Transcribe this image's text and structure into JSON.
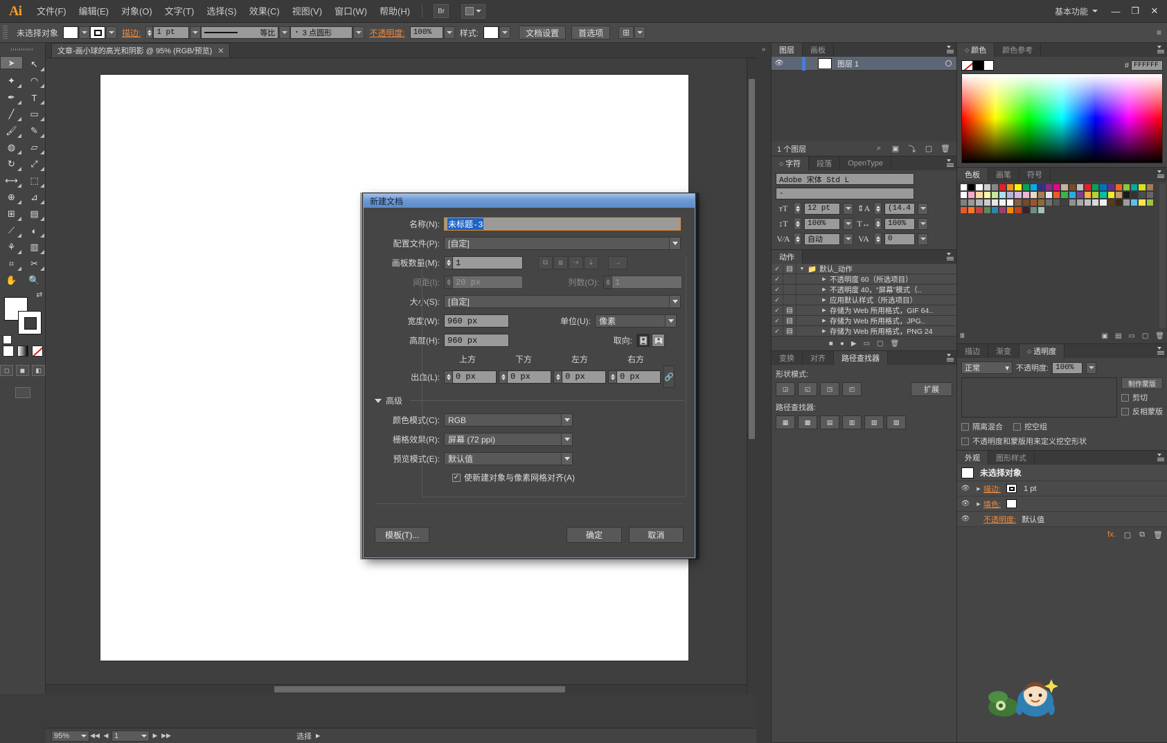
{
  "app": {
    "logo": "Ai",
    "menus": [
      "文件(F)",
      "编辑(E)",
      "对象(O)",
      "文字(T)",
      "选择(S)",
      "效果(C)",
      "视图(V)",
      "窗口(W)",
      "帮助(H)"
    ],
    "bridge_label": "Br",
    "workspace_label": "基本功能",
    "window_buttons": {
      "minimize": "—",
      "maximize": "❐",
      "close": "✕"
    }
  },
  "control_bar": {
    "selection_status": "未选择对象",
    "stroke_label": "描边:",
    "stroke_weight": "1 pt",
    "profile_label": "等比",
    "brush_label": "3 点圆形",
    "opacity_label": "不透明度:",
    "opacity_value": "100%",
    "style_label": "样式:",
    "doc_setup_button": "文档设置",
    "preferences_button": "首选项"
  },
  "document_tab": {
    "title": "文章-画小球的高光和阴影 @ 95% (RGB/预览)",
    "close": "✕"
  },
  "status_bar": {
    "zoom": "95%",
    "page": "1",
    "tool_status": "选择",
    "first": "◀◀",
    "prev": "◀",
    "next": "▶",
    "last": "▶▶"
  },
  "dialog": {
    "title": "新建文档",
    "fields": {
      "name_label": "名称(N):",
      "name_value": "未标题-3",
      "profile_label": "配置文件(P):",
      "profile_value": "[自定]",
      "artboards_label": "画板数量(M):",
      "artboards_value": "1",
      "spacing_label": "间距(I):",
      "spacing_value": "20 px",
      "columns_label": "列数(O):",
      "columns_value": "1",
      "size_label": "大小(S):",
      "size_value": "[自定]",
      "width_label": "宽度(W):",
      "width_value": "960 px",
      "units_label": "单位(U):",
      "units_value": "像素",
      "height_label": "高度(H):",
      "height_value": "960 px",
      "orientation_label": "取向:",
      "bleed_label": "出血(L):",
      "bleed_top_header": "上方",
      "bleed_bottom_header": "下方",
      "bleed_left_header": "左方",
      "bleed_right_header": "右方",
      "bleed_top": "0 px",
      "bleed_bottom": "0 px",
      "bleed_left": "0 px",
      "bleed_right": "0 px",
      "advanced_label": "高级",
      "color_mode_label": "颜色模式(C):",
      "color_mode_value": "RGB",
      "raster_label": "栅格效果(R):",
      "raster_value": "屏幕 (72 ppi)",
      "preview_label": "预览模式(E):",
      "preview_value": "默认值",
      "align_pixel_label": "使新建对象与像素网格对齐(A)",
      "align_pixel_checked": "✓"
    },
    "buttons": {
      "template": "模板(T)...",
      "ok": "确定",
      "cancel": "取消"
    }
  },
  "panels": {
    "layers": {
      "tabs": [
        "图层",
        "画板"
      ],
      "active_tab": "图层",
      "rows": [
        {
          "name": "图层 1"
        }
      ],
      "footer_count": "1 个图层"
    },
    "character": {
      "tabs": [
        "字符",
        "段落",
        "OpenType"
      ],
      "active_tab": "字符",
      "font_family": "Adobe 宋体 Std L",
      "font_style": "-",
      "font_size": "12 pt",
      "leading": "(14.4",
      "vertical_scale": "100%",
      "horizontal_scale": "100%",
      "kerning": "自动",
      "tracking": "0"
    },
    "actions": {
      "tabs": [
        "动作"
      ],
      "active_tab": "动作",
      "rows": [
        {
          "check": "✓",
          "box": "▤",
          "tri": "▼",
          "label": "默认_动作",
          "folder": true,
          "indent": 0
        },
        {
          "check": "✓",
          "box": "",
          "tri": "▶",
          "label": "不透明度 60（所选项目）",
          "indent": 1
        },
        {
          "check": "✓",
          "box": "",
          "tri": "▶",
          "label": "不透明度 40，“屏幕”模式（..",
          "indent": 1
        },
        {
          "check": "✓",
          "box": "",
          "tri": "▶",
          "label": "应用默认样式（所选项目）",
          "indent": 1
        },
        {
          "check": "✓",
          "box": "▤",
          "tri": "▶",
          "label": "存储为 Web 所用格式，GIF 64..",
          "indent": 1
        },
        {
          "check": "✓",
          "box": "▤",
          "tri": "▶",
          "label": "存储为 Web 所用格式，JPG..",
          "indent": 1
        },
        {
          "check": "✓",
          "box": "▤",
          "tri": "▶",
          "label": "存储为 Web 所用格式，PNG 24",
          "indent": 1
        }
      ]
    },
    "pathfinder": {
      "tabs": [
        "变换",
        "对齐",
        "路径查找器"
      ],
      "active_tab": "路径查找器",
      "shape_modes_label": "形状模式:",
      "expand_button": "扩展",
      "pathfinders_label": "路径查找器:"
    },
    "color": {
      "tabs": [
        "颜色",
        "颜色参考"
      ],
      "active_tab": "颜色",
      "hex_prefix": "#",
      "hex_value": "FFFFFF"
    },
    "swatches": {
      "tabs": [
        "色板",
        "画笔",
        "符号"
      ],
      "active_tab": "色板"
    },
    "transparency": {
      "tabs": [
        "描边",
        "渐变",
        "透明度"
      ],
      "active_tab": "透明度",
      "blend_mode": "正常",
      "opacity_label": "不透明度:",
      "opacity_value": "100%",
      "make_mask_button": "制作蒙版",
      "clip_label": "剪切",
      "invert_label": "反相蒙版",
      "isolate_label": "隔离混合",
      "knockout_label": "挖空组",
      "opacity_mask_label": "不透明度和蒙版用来定义挖空形状"
    },
    "appearance": {
      "tabs": [
        "外观",
        "图形样式"
      ],
      "active_tab": "外观",
      "header": "未选择对象",
      "rows": [
        {
          "label": "描边:",
          "value": "1 pt",
          "eye": "👁"
        },
        {
          "label": "填色:",
          "value": "",
          "eye": "👁"
        },
        {
          "label": "不透明度:",
          "value": "默认值",
          "eye": ""
        }
      ]
    }
  },
  "colors": {
    "accent_orange": "#f08a3c",
    "dialog_title_blue": "#6e99d2",
    "selection_blue": "#1c63c8",
    "panel_bg": "#454545",
    "app_bg": "#3c3c3c"
  }
}
